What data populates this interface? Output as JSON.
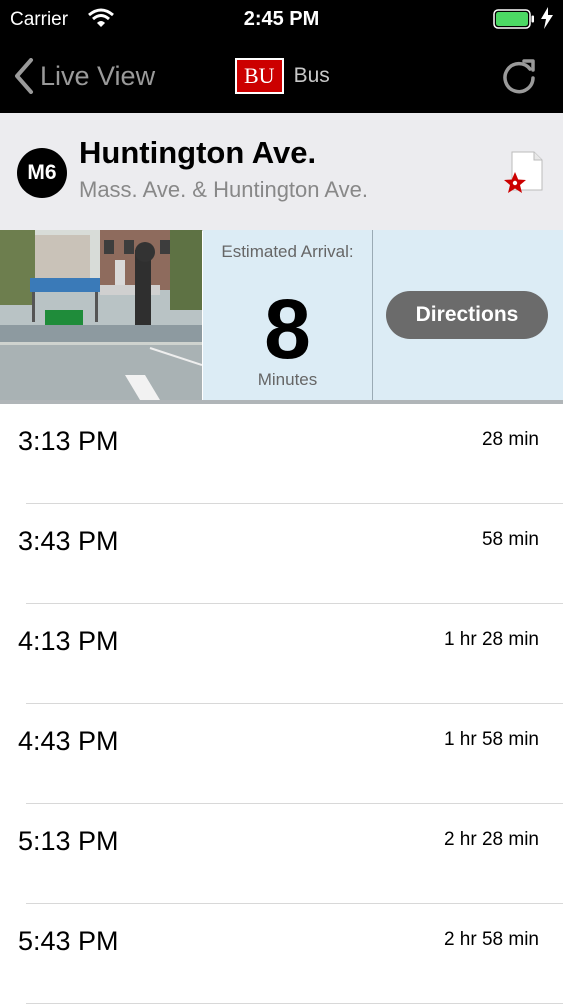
{
  "status_bar": {
    "carrier": "Carrier",
    "time": "2:45 PM"
  },
  "nav": {
    "back_label": "Live View",
    "logo_text": "BU",
    "logo_suffix": "Bus"
  },
  "stop": {
    "route": "M6",
    "name": "Huntington Ave.",
    "cross_streets": "Mass. Ave. & Huntington Ave."
  },
  "eta": {
    "label": "Estimated Arrival:",
    "value": "8",
    "unit": "Minutes"
  },
  "directions_label": "Directions",
  "departures": [
    {
      "time": "3:13 PM",
      "eta": "28 min"
    },
    {
      "time": "3:43 PM",
      "eta": "58 min"
    },
    {
      "time": "4:13 PM",
      "eta": "1 hr 28 min"
    },
    {
      "time": "4:43 PM",
      "eta": "1 hr 58 min"
    },
    {
      "time": "5:13 PM",
      "eta": "2 hr 28 min"
    },
    {
      "time": "5:43 PM",
      "eta": "2 hr 58 min"
    }
  ],
  "colors": {
    "brand_red": "#cc0000",
    "panel_blue": "#dcecf5",
    "battery_green": "#4cd964"
  }
}
